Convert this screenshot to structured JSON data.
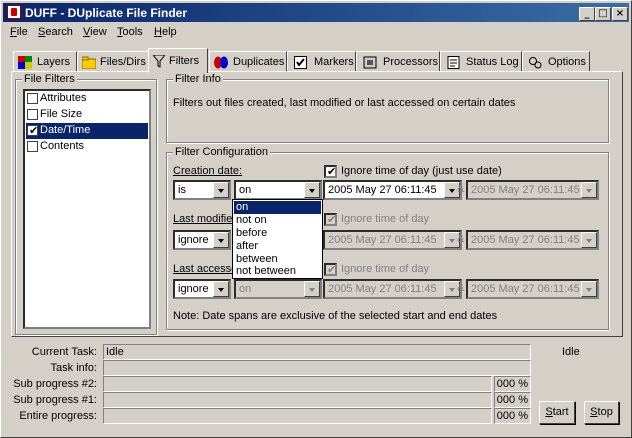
{
  "window": {
    "title": "DUFF - DUplicate File Finder"
  },
  "menu": [
    {
      "underline": "F",
      "rest": "ile"
    },
    {
      "underline": "S",
      "rest": "earch"
    },
    {
      "underline": "V",
      "rest": "iew"
    },
    {
      "underline": "T",
      "rest": "ools"
    },
    {
      "underline": "H",
      "rest": "elp"
    }
  ],
  "tabs": [
    "Layers",
    "Files/Dirs",
    "Filters",
    "Duplicates",
    "Markers",
    "Processors",
    "Status Log",
    "Options"
  ],
  "active_tab": "Filters",
  "file_filters": {
    "title": "File Filters",
    "items": [
      {
        "label": "Attributes",
        "checked": false
      },
      {
        "label": "File Size",
        "checked": false
      },
      {
        "label": "Date/Time",
        "checked": true,
        "selected": true
      },
      {
        "label": "Contents",
        "checked": false
      }
    ]
  },
  "filter_info": {
    "title": "Filter Info",
    "text": "Filters out files created, last modified or last accessed on certain dates"
  },
  "filter_config": {
    "title": "Filter Configuration",
    "creation": {
      "label": "Creation date:",
      "mode": "is",
      "op": "on",
      "ignore_label": "Ignore time of day (just use date)",
      "start": "2005 May 27 06:11:45",
      "end": "2005 May 27 06:11:45",
      "amp": "&"
    },
    "modified": {
      "label": "Last modified",
      "mode": "ignore",
      "ignore_label": "Ignore time of day",
      "start": "2005 May 27 06:11:45",
      "end": "2005 May 27 06:11:45",
      "amp": "&"
    },
    "accessed": {
      "label": "Last accessed",
      "mode": "ignore",
      "op": "on",
      "ignore_label": "Ignore time of day",
      "start": "2005 May 27 06:11:45",
      "end": "2005 May 27 06:11:45",
      "amp": "&"
    },
    "note": "Note: Date spans are exclusive of the selected start and end dates"
  },
  "dropdown_options": [
    "on",
    "not on",
    "before",
    "after",
    "between",
    "not between"
  ],
  "dropdown_selected": "on",
  "status": {
    "current_task_label": "Current Task:",
    "current_task": "Idle",
    "task_info_label": "Task info:",
    "task_info": "",
    "sub2_label": "Sub progress #2:",
    "sub2_pct": "000 %",
    "sub1_label": "Sub progress #1:",
    "sub1_pct": "000 %",
    "entire_label": "Entire progress:",
    "entire_pct": "000 %",
    "state": "Idle"
  },
  "buttons": {
    "start": {
      "underline": "S",
      "rest": "tart"
    },
    "stop": {
      "underline": "S",
      "rest": "top"
    }
  },
  "colors": {
    "title_bar": "#0a246a",
    "selection": "#0a246a",
    "face": "#d4d0c8"
  }
}
